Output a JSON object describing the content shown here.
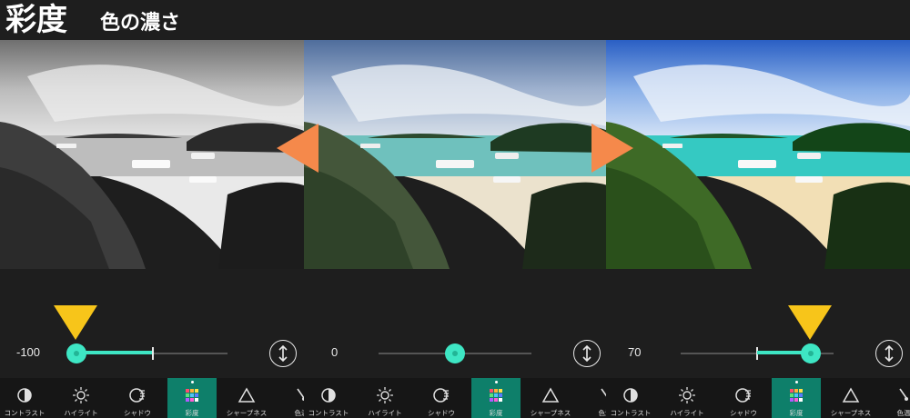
{
  "title": {
    "main": "彩度",
    "sub": "色の濃さ"
  },
  "panels": [
    {
      "value": "-100",
      "saturation": -100
    },
    {
      "value": "0",
      "saturation": 0
    },
    {
      "value": "70",
      "saturation": 70
    }
  ],
  "slider": {
    "min": -100,
    "max": 100
  },
  "tools": {
    "contrast": "コントラスト",
    "highlight": "ハイライト",
    "shadow": "シャドウ",
    "saturation": "彩度",
    "sharpness": "シャープネス",
    "color_temp": "色温"
  },
  "colors": {
    "accent": "#3ee6c4",
    "active_tab": "#0e7f6a",
    "marker": "#f7c51a",
    "arrow": "#f5894b"
  }
}
